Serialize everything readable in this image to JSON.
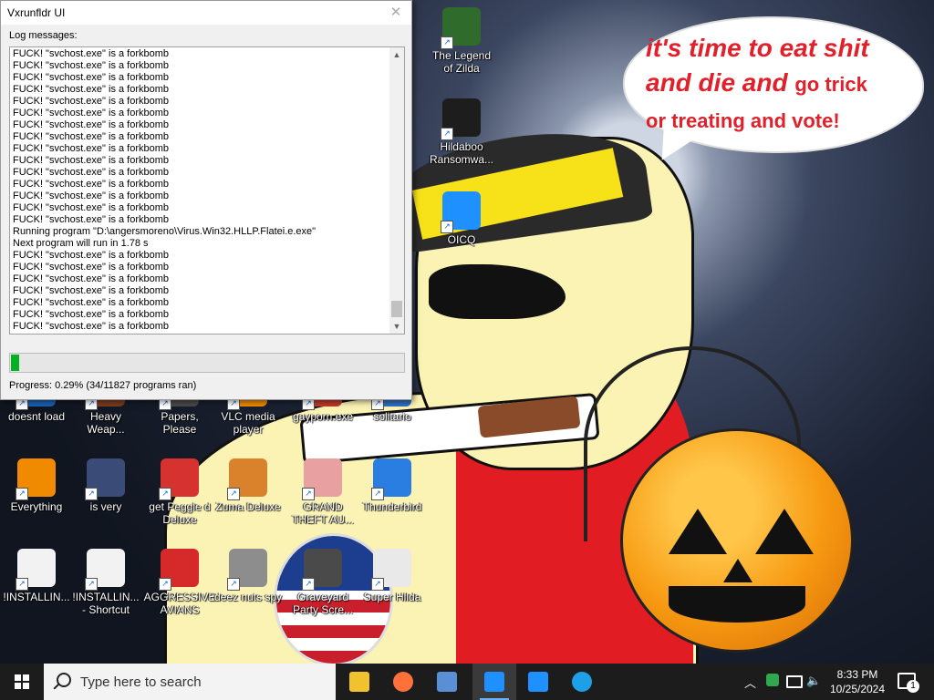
{
  "window": {
    "title": "Vxrunfldr UI",
    "close_icon": "close-icon",
    "log_label": "Log messages:",
    "log_lines": [
      "FUCK! \"svchost.exe\" is a forkbomb",
      "FUCK! \"svchost.exe\" is a forkbomb",
      "FUCK! \"svchost.exe\" is a forkbomb",
      "FUCK! \"svchost.exe\" is a forkbomb",
      "FUCK! \"svchost.exe\" is a forkbomb",
      "FUCK! \"svchost.exe\" is a forkbomb",
      "FUCK! \"svchost.exe\" is a forkbomb",
      "FUCK! \"svchost.exe\" is a forkbomb",
      "FUCK! \"svchost.exe\" is a forkbomb",
      "FUCK! \"svchost.exe\" is a forkbomb",
      "FUCK! \"svchost.exe\" is a forkbomb",
      "FUCK! \"svchost.exe\" is a forkbomb",
      "FUCK! \"svchost.exe\" is a forkbomb",
      "FUCK! \"svchost.exe\" is a forkbomb",
      "FUCK! \"svchost.exe\" is a forkbomb",
      "Running program \"D:\\angersmoreno\\Virus.Win32.HLLP.Flatei.e.exe\"",
      "Next program will run in 1.78 s",
      "FUCK! \"svchost.exe\" is a forkbomb",
      "FUCK! \"svchost.exe\" is a forkbomb",
      "FUCK! \"svchost.exe\" is a forkbomb",
      "FUCK! \"svchost.exe\" is a forkbomb",
      "FUCK! \"svchost.exe\" is a forkbomb",
      "FUCK! \"svchost.exe\" is a forkbomb",
      "FUCK! \"svchost.exe\" is a forkbomb",
      "FUCK! \"svchost.exe\" is a forkbomb"
    ],
    "progress_fraction": 0.0029,
    "progress_text": "Progress: 0.29% (34/11827 programs ran)",
    "progress_color": "#06b025"
  },
  "wallpaper": {
    "speech_line1": "it's time to eat shit",
    "speech_line2a": "and die and ",
    "speech_line2b": "go trick",
    "speech_line3": "or treating and vote!",
    "speech_color": "#e0202a"
  },
  "desktop_icons": [
    {
      "label": "The Legend\nof Zilda",
      "icon": "zelda-character-icon",
      "color": "#2f6b2a"
    },
    {
      "label": "Hildaboo\nRansomwa...",
      "icon": "yashma-shield-icon",
      "color": "#1d1d1d"
    },
    {
      "label": "OICQ",
      "icon": "window-app-icon",
      "color": "#1e90ff"
    },
    {
      "label": "doesnt load",
      "icon": "app-icon",
      "color": "#1a5fb4"
    },
    {
      "label": "Heavy\nWeap...",
      "icon": "game-icon",
      "color": "#7a3b1e"
    },
    {
      "label": "Papers, Please",
      "icon": "game-icon",
      "color": "#4a4a4a"
    },
    {
      "label": "VLC media\nplayer",
      "icon": "vlc-cone-icon",
      "color": "#f08a00"
    },
    {
      "label": "gayporn.exe",
      "icon": "exe-icon",
      "color": "#c0392b"
    },
    {
      "label": "solitario",
      "icon": "cards-icon",
      "color": "#2c6fbf"
    },
    {
      "label": "Everything",
      "icon": "magnifier-icon",
      "color": "#f08a00"
    },
    {
      "label": "is very",
      "icon": "shield-icon",
      "color": "#3b4b78"
    },
    {
      "label": "get Peggle d\nDeluxe",
      "icon": "peggle-icon",
      "color": "#d6322f"
    },
    {
      "label": "Zuma Deluxe",
      "icon": "zuma-icon",
      "color": "#d9822b"
    },
    {
      "label": "GRAND\nTHEFT AU...",
      "icon": "character-icon",
      "color": "#e8a0a0"
    },
    {
      "label": "Thunderbird",
      "icon": "thunderbird-icon",
      "color": "#2a7de1"
    },
    {
      "label": "!INSTALLIN...",
      "icon": "text-document-icon",
      "color": "#f2f2f2"
    },
    {
      "label": "!INSTALLIN...\n- Shortcut",
      "icon": "text-document-icon",
      "color": "#f2f2f2"
    },
    {
      "label": "AGGRESSIVE\nAVIANS",
      "icon": "angry-bird-icon",
      "color": "#d62a2a"
    },
    {
      "label": "deez nuts spy",
      "icon": "windows-stack-icon",
      "color": "#8d8d8d"
    },
    {
      "label": "Graveyard\nParty Scre...",
      "icon": "graveyard-icon",
      "color": "#4a4a4a"
    },
    {
      "label": "Super Hilda",
      "icon": "pixel-character-icon",
      "color": "#e9e9e9"
    }
  ],
  "taskbar": {
    "search_placeholder": "Type here to search",
    "apps": [
      {
        "name": "file-explorer-icon",
        "color": "#f2c12e"
      },
      {
        "name": "firefox-icon",
        "color": "#ff7139"
      },
      {
        "name": "app-window-icon",
        "color": "#5a8fd6"
      },
      {
        "name": "app-window-icon",
        "color": "#1e90ff"
      },
      {
        "name": "app-window-icon",
        "color": "#1e90ff"
      },
      {
        "name": "internet-explorer-icon",
        "color": "#1ea0e8"
      }
    ],
    "time": "8:33 PM",
    "date": "10/25/2024",
    "notification_count": "1"
  }
}
